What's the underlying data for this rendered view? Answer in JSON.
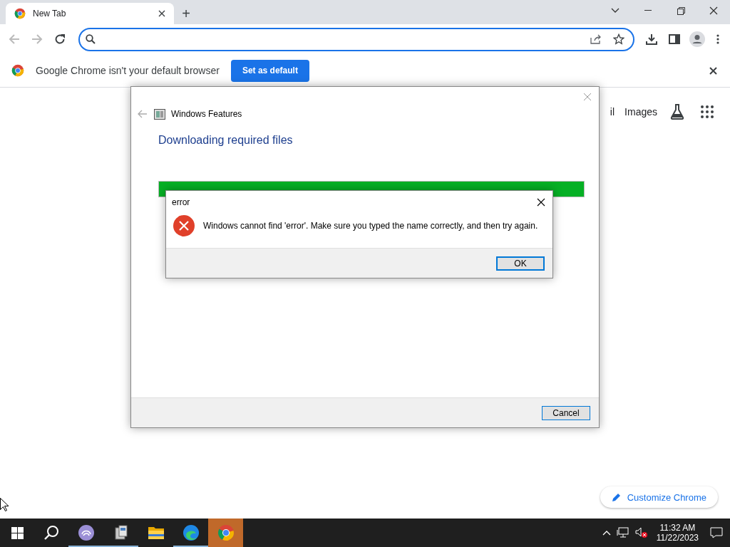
{
  "browser": {
    "tabs": [
      {
        "title": "New Tab",
        "selected": true
      }
    ],
    "new_tab_button": "+",
    "infobar": {
      "message": "Google Chrome isn't your default browser",
      "button": "Set as default"
    },
    "ntp": {
      "links": [
        "il",
        "Images"
      ],
      "customize_button": "Customize Chrome"
    }
  },
  "features_dialog": {
    "title": "Windows Features",
    "heading": "Downloading required files",
    "progress": {
      "level": 1
    },
    "cancel": "Cancel"
  },
  "error_dialog": {
    "title": "error",
    "message": "Windows cannot find 'error'. Make sure you typed the name correctly, and then try again.",
    "ok": "OK"
  },
  "taskbar": {
    "apps": [
      {
        "kind": "torrent",
        "selected": false
      },
      {
        "kind": "installer",
        "selected": false
      },
      {
        "kind": "folder",
        "selected": false
      },
      {
        "kind": "edge",
        "selected": false
      },
      {
        "kind": "chrome",
        "selected": true
      }
    ],
    "time": "11:32 AM",
    "date": "11/22/2023"
  }
}
